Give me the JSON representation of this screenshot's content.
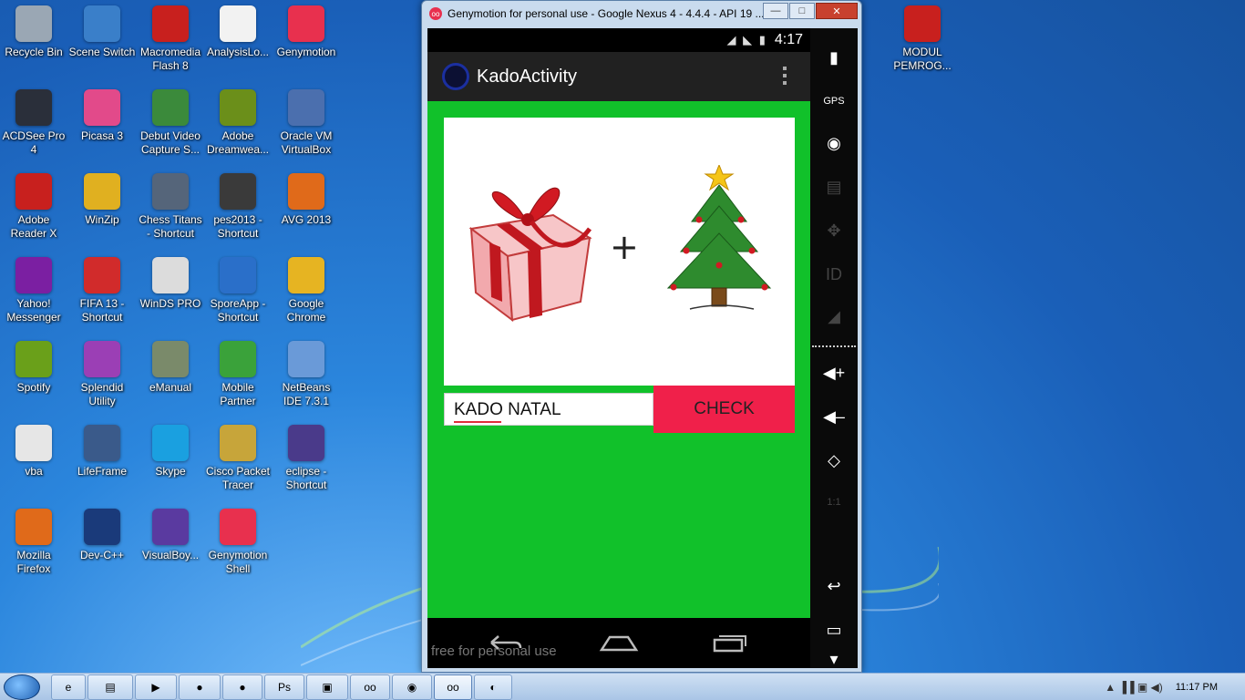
{
  "desktop_icons": [
    {
      "label": "Recycle Bin",
      "icon": "recycle-bin-icon",
      "color": "#9aa7b4"
    },
    {
      "label": "Scene Switch",
      "icon": "scene-switch-icon",
      "color": "#3a7fc9"
    },
    {
      "label": "Macromedia Flash 8",
      "icon": "flash-icon",
      "color": "#c8201e"
    },
    {
      "label": "AnalysisLo...",
      "icon": "document-icon",
      "color": "#f2f2f2"
    },
    {
      "label": "Genymotion",
      "icon": "genymotion-icon",
      "color": "#e8304e"
    },
    {
      "label": "ACDSee Pro 4",
      "icon": "camera-icon",
      "color": "#2a2f3a"
    },
    {
      "label": "Picasa 3",
      "icon": "picasa-icon",
      "color": "#e24a8a"
    },
    {
      "label": "Debut Video Capture S...",
      "icon": "video-capture-icon",
      "color": "#3b8a3b"
    },
    {
      "label": "Adobe Dreamwea...",
      "icon": "dreamweaver-icon",
      "color": "#6b8f1a"
    },
    {
      "label": "Oracle VM VirtualBox",
      "icon": "virtualbox-icon",
      "color": "#4b6fae"
    },
    {
      "label": "Adobe Reader X",
      "icon": "adobe-reader-icon",
      "color": "#c8201e"
    },
    {
      "label": "WinZip",
      "icon": "winzip-icon",
      "color": "#e0b020"
    },
    {
      "label": "Chess Titans - Shortcut",
      "icon": "chess-icon",
      "color": "#55657a"
    },
    {
      "label": "pes2013 - Shortcut",
      "icon": "pes-icon",
      "color": "#3a3a3a"
    },
    {
      "label": "AVG 2013",
      "icon": "avg-icon",
      "color": "#e06a1a"
    },
    {
      "label": "Yahoo! Messenger",
      "icon": "yahoo-icon",
      "color": "#7b1fa2"
    },
    {
      "label": "FIFA 13 - Shortcut",
      "icon": "fifa-icon",
      "color": "#d12b2b"
    },
    {
      "label": "WinDS PRO",
      "icon": "nintendo-ds-icon",
      "color": "#dcdcdc"
    },
    {
      "label": "SporeApp - Shortcut",
      "icon": "spore-icon",
      "color": "#2a6fc9"
    },
    {
      "label": "Google Chrome",
      "icon": "chrome-icon",
      "color": "#e6b422"
    },
    {
      "label": "Spotify",
      "icon": "spotify-icon",
      "color": "#6aa01a"
    },
    {
      "label": "Splendid Utility",
      "icon": "splendid-icon",
      "color": "#9b3fb5"
    },
    {
      "label": "eManual",
      "icon": "emanual-icon",
      "color": "#7a8a6a"
    },
    {
      "label": "Mobile Partner",
      "icon": "mobile-partner-icon",
      "color": "#3aa23a"
    },
    {
      "label": "NetBeans IDE 7.3.1",
      "icon": "netbeans-icon",
      "color": "#6a9ad8"
    },
    {
      "label": "vba",
      "icon": "vba-file-icon",
      "color": "#e6e6e6"
    },
    {
      "label": "LifeFrame",
      "icon": "lifeframe-icon",
      "color": "#3a5a8a"
    },
    {
      "label": "Skype",
      "icon": "skype-icon",
      "color": "#1aa0e0"
    },
    {
      "label": "Cisco Packet Tracer",
      "icon": "cisco-icon",
      "color": "#c7a53a"
    },
    {
      "label": "eclipse - Shortcut",
      "icon": "eclipse-icon",
      "color": "#4a3a8a"
    },
    {
      "label": "Mozilla Firefox",
      "icon": "firefox-icon",
      "color": "#e06a1a"
    },
    {
      "label": "Dev-C++",
      "icon": "devcpp-icon",
      "color": "#1a3a7a"
    },
    {
      "label": "VisualBoy...",
      "icon": "visualboy-icon",
      "color": "#5a3aa0"
    },
    {
      "label": "Genymotion Shell",
      "icon": "genymotion-shell-icon",
      "color": "#e8304e"
    },
    {
      "label": "MODUL PEMROG...",
      "icon": "pdf-file-icon",
      "color": "#c8201e"
    }
  ],
  "emulator": {
    "title": "Genymotion for personal use - Google Nexus 4 - 4.4.4 - API 19 ...",
    "title_icon": "oo",
    "minimize": "—",
    "maximize": "□",
    "close": "✕",
    "status_time": "4:17",
    "status_icons": "◢ ◣ ▮",
    "app_title": "KadoActivity",
    "plus_sign": "+",
    "input_value": "KADO NATAL",
    "check_button": "CHECK",
    "watermark": "free for personal use"
  },
  "side_panel": [
    {
      "icon": "battery-icon",
      "glyph": "▮",
      "enabled": true
    },
    {
      "icon": "gps-icon",
      "glyph": "GPS",
      "enabled": true
    },
    {
      "icon": "webcam-icon",
      "glyph": "◉",
      "enabled": true
    },
    {
      "icon": "media-icon",
      "glyph": "▤",
      "enabled": false
    },
    {
      "icon": "dpad-icon",
      "glyph": "✥",
      "enabled": false
    },
    {
      "icon": "id-icon",
      "glyph": "ID",
      "enabled": false
    },
    {
      "icon": "network-icon",
      "glyph": "◢",
      "enabled": false
    },
    {
      "icon": "volume-up-icon",
      "glyph": "◀+",
      "enabled": true
    },
    {
      "icon": "volume-down-icon",
      "glyph": "◀–",
      "enabled": true
    },
    {
      "icon": "rotate-icon",
      "glyph": "◇",
      "enabled": true
    },
    {
      "icon": "scale-icon",
      "glyph": "1:1",
      "enabled": false
    },
    {
      "icon": "back-icon",
      "glyph": "↩",
      "enabled": true
    },
    {
      "icon": "recent-apps-icon",
      "glyph": "▭",
      "enabled": true
    },
    {
      "icon": "menu-down-icon",
      "glyph": "▾",
      "enabled": true
    }
  ],
  "taskbar": {
    "items": [
      {
        "icon": "ie-icon",
        "glyph": "e"
      },
      {
        "icon": "explorer-icon",
        "glyph": "▤"
      },
      {
        "icon": "media-player-icon",
        "glyph": "▶"
      },
      {
        "icon": "chrome-icon",
        "glyph": "●"
      },
      {
        "icon": "firefox-icon",
        "glyph": "●"
      },
      {
        "icon": "photoshop-icon",
        "glyph": "Ps"
      },
      {
        "icon": "virtualbox-icon",
        "glyph": "▣"
      },
      {
        "icon": "genymotion-icon",
        "glyph": "oo"
      },
      {
        "icon": "android-studio-icon",
        "glyph": "◉"
      },
      {
        "icon": "genymotion-window-icon",
        "glyph": "oo"
      },
      {
        "icon": "paint-icon",
        "glyph": "◐"
      }
    ],
    "clock": "11:17 PM",
    "tray_icons": "▲  ▐▐  ▣  ◀)"
  }
}
